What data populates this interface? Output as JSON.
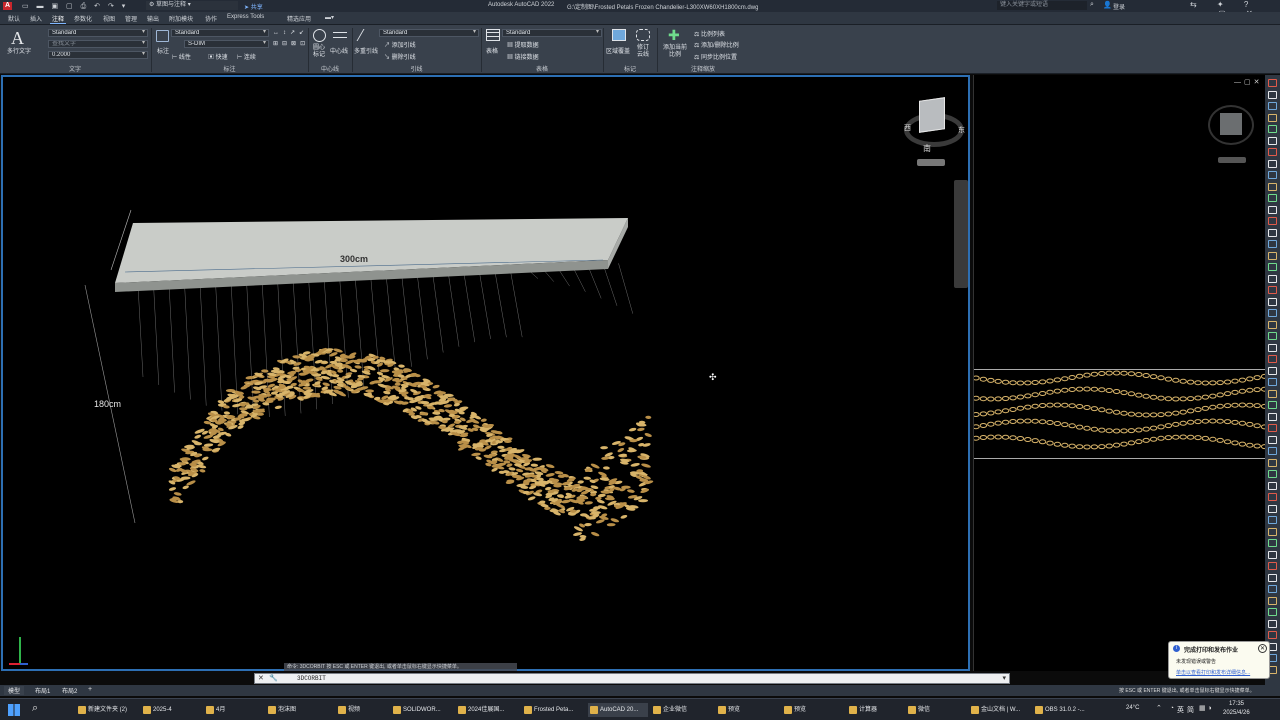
{
  "app": {
    "title": "Autodesk AutoCAD 2022",
    "file": "G:\\定制图\\Frosted Petals Frozen Chandelier-L300XW60XH1800cm.dwg",
    "workspace": "草图与注释",
    "share": "共享",
    "search_placeholder": "键入关键字或短语",
    "login": "登录"
  },
  "tabs": [
    "默认",
    "插入",
    "注释",
    "参数化",
    "视图",
    "管理",
    "输出",
    "附加模块",
    "协作",
    "Express Tools",
    "精选应用"
  ],
  "active_tab": "注释",
  "ribbon": {
    "text": {
      "big": "多行文字",
      "style": "Standard",
      "find": "查找文字",
      "height": "0.2000",
      "group": "文字"
    },
    "dim": {
      "big": "标注",
      "style": "Standard",
      "layer": "S-DIM",
      "linear": "线性",
      "quick": "快速",
      "cont": "连续",
      "group": "标注"
    },
    "center": {
      "mark": "圆心标记",
      "line": "中心线",
      "group": "中心线"
    },
    "leader": {
      "big": "多重引线",
      "style": "Standard",
      "add": "添加引线",
      "del": "删除引线",
      "group": "引线"
    },
    "table": {
      "big": "表格",
      "style": "Standard",
      "extract": "提取数据",
      "link": "链接数据",
      "group": "表格"
    },
    "markup": {
      "wipe": "区域覆盖",
      "cloud": "修订云线",
      "group": "标记"
    },
    "scale": {
      "add": "添加当前比例",
      "list": "比例列表",
      "adddel": "添加/删除比例",
      "sync": "同步比例位置",
      "group": "注释缩放"
    }
  },
  "viewport": {
    "dim_width": "300cm",
    "dim_height": "180cm",
    "viewcube": {
      "n": "北",
      "s": "南",
      "e": "东",
      "w": "西"
    }
  },
  "command": {
    "history": "命令: 3DCORBIT 按 ESC 或 ENTER 键退出, 或者单击鼠标右键显示快捷菜单。",
    "input": "3DCORBIT",
    "status": "按 ESC 或 ENTER 键退出, 或者单击鼠标右键显示快捷菜单。"
  },
  "model_tabs": [
    "模型",
    "布局1",
    "布局2"
  ],
  "notification": {
    "title": "完成打印和发布作业",
    "line1": "未发现错误或警告",
    "link": "单击以查看打印和发布详细信息..."
  },
  "taskbar": {
    "items": [
      "新建文件夹 (2)",
      "2025-4",
      "4月",
      "泡沫图",
      "视频",
      "SOLIDWOR...",
      "2024佳展国...",
      "Frosted Peta...",
      "AutoCAD 20...",
      "企业微信",
      "预览",
      "预览",
      "计算器",
      "微信",
      "金山文档 | W...",
      "OBS 31.0.2 -..."
    ],
    "temp": "24°C",
    "lang": "英",
    "ime": "简",
    "time": "17:35",
    "date": "2025/4/26"
  },
  "colors": {
    "accent": "#2d6fb3",
    "petal": "#d8b46a",
    "slab": "#c9ccc8"
  }
}
